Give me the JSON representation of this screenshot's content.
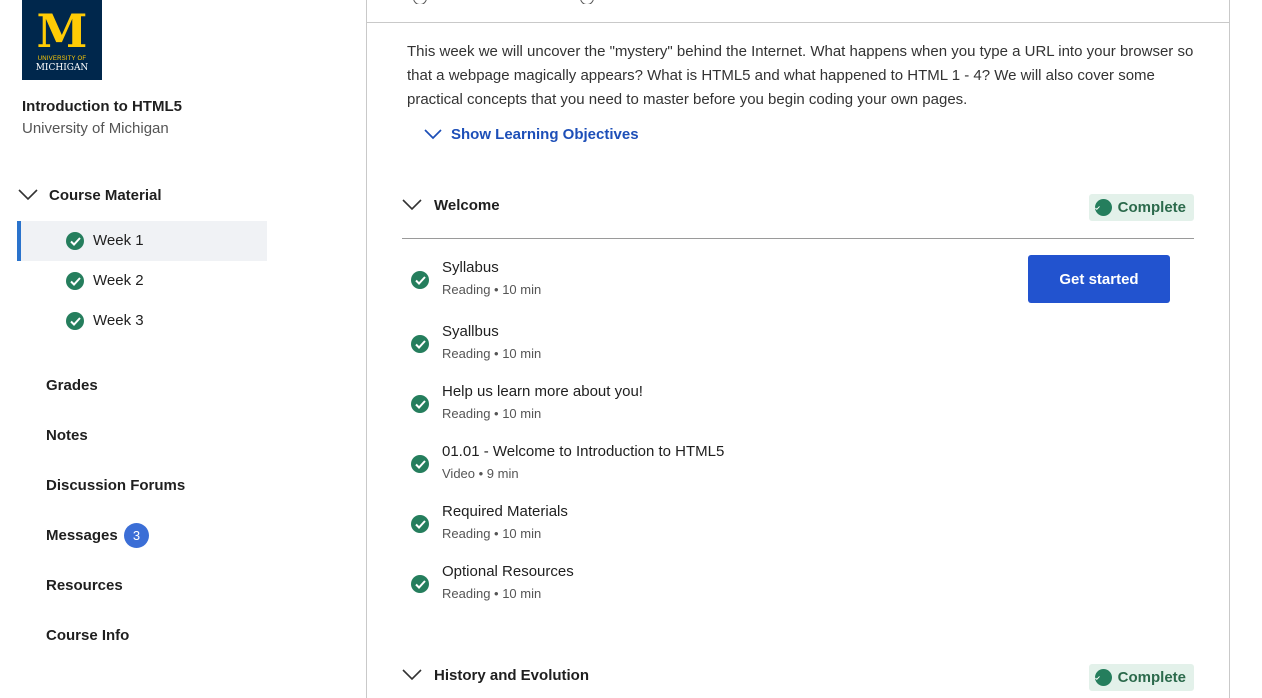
{
  "sidebar": {
    "logo": {
      "letter": "M",
      "line1": "UNIVERSITY OF",
      "line2": "MICHIGAN"
    },
    "course_title": "Introduction to HTML5",
    "course_org": "University of Michigan",
    "course_material_label": "Course Material",
    "weeks": [
      {
        "label": "Week 1",
        "active": true,
        "done": true
      },
      {
        "label": "Week 2",
        "active": false,
        "done": true
      },
      {
        "label": "Week 3",
        "active": false,
        "done": true
      }
    ],
    "links": {
      "grades": "Grades",
      "notes": "Notes",
      "discussion": "Discussion Forums",
      "messages": "Messages",
      "messages_count": "3",
      "resources": "Resources",
      "course_info": "Course Info"
    }
  },
  "main": {
    "description": "This week we will uncover the \"mystery\" behind the Internet. What happens when you type a URL into your browser so that a webpage magically appears? What is HTML5 and what happened to HTML 1 - 4? We will also cover some practical concepts that you need to master before you begin coding your own pages.",
    "show_objectives": "Show Learning Objectives",
    "sections": [
      {
        "name": "Welcome",
        "status": "Complete",
        "items": [
          {
            "title": "Syllabus",
            "meta": "Reading • 10 min"
          },
          {
            "title": "Syallbus",
            "meta": "Reading • 10 min"
          },
          {
            "title": "Help us learn more about you!",
            "meta": "Reading • 10 min"
          },
          {
            "title": "01.01 - Welcome to Introduction to HTML5",
            "meta": "Video • 9 min"
          },
          {
            "title": "Required Materials",
            "meta": "Reading • 10 min"
          },
          {
            "title": "Optional Resources",
            "meta": "Reading • 10 min"
          }
        ]
      },
      {
        "name": "History and Evolution",
        "status": "Complete"
      }
    ],
    "get_started_label": "Get started"
  },
  "colors": {
    "accent": "#2253cf",
    "link": "#1d4fb8",
    "success": "#257e5d",
    "success_bg": "#e3f1ea",
    "badge": "#3b6ed6",
    "logo_blue": "#00274c",
    "logo_maize": "#ffcb05"
  },
  "icons": {
    "check": "check-circle-icon",
    "chevron": "chevron-down-icon"
  }
}
